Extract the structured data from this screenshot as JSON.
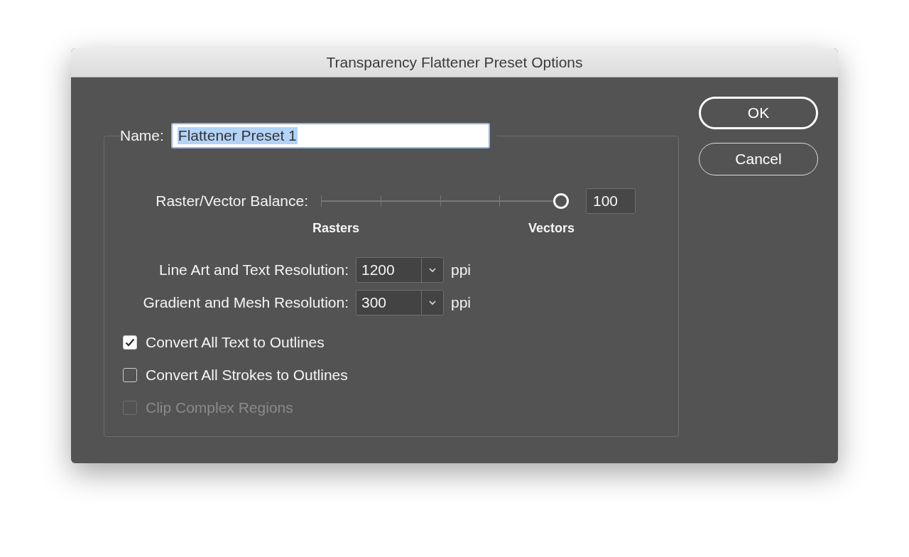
{
  "window": {
    "title": "Transparency Flattener Preset Options"
  },
  "name_field": {
    "label": "Name:",
    "value": "Flattener Preset 1",
    "text_selected": true
  },
  "balance": {
    "label": "Raster/Vector Balance:",
    "level": 1,
    "value": "100",
    "min_label": "Rasters",
    "max_label": "Vectors"
  },
  "resolutions": [
    {
      "label": "Line Art and Text Resolution:",
      "value": "1200",
      "unit": "ppi"
    },
    {
      "label": "Gradient and Mesh Resolution:",
      "value": "300",
      "unit": "ppi"
    }
  ],
  "options": [
    {
      "label": "Convert All Text to Outlines",
      "checked": true,
      "disabled": false
    },
    {
      "label": "Convert All Strokes to Outlines",
      "checked": false,
      "disabled": false
    },
    {
      "label": "Clip Complex Regions",
      "checked": false,
      "disabled": true
    }
  ],
  "buttons": [
    {
      "label": "OK",
      "default": true
    },
    {
      "label": "Cancel",
      "default": false
    }
  ]
}
